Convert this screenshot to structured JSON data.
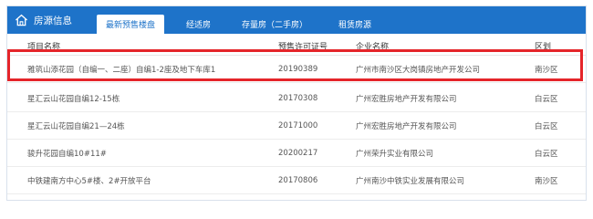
{
  "header": {
    "title": "房源信息",
    "accent_color": "#1e73c9",
    "tabs": [
      {
        "label": "最新预售楼盘",
        "active": true
      },
      {
        "label": "经适房",
        "active": false
      },
      {
        "label": "存量房（二手房）",
        "active": false
      },
      {
        "label": "租赁房源",
        "active": false
      }
    ]
  },
  "table": {
    "columns": [
      "项目名称",
      "预售许可证号",
      "企业名称",
      "区划"
    ],
    "rows": [
      {
        "name": "雅筑山添花园（自编一、二座）自编1-2座及地下车库1",
        "permit": "20190389",
        "company": "广州市南沙区大岗镇房地产开发公司",
        "district": "南沙区",
        "highlighted": true
      },
      {
        "name": "星汇云山花园自编12-15栋",
        "permit": "20170308",
        "company": "广州宏胜房地产开发有限公司",
        "district": "白云区"
      },
      {
        "name": "星汇云山花园自编21—24栋",
        "permit": "20171000",
        "company": "广州宏胜房地产开发有限公司",
        "district": "白云区"
      },
      {
        "name": "骏升花园自编10#11#",
        "permit": "20200217",
        "company": "广州荣升实业有限公司",
        "district": "白云区"
      },
      {
        "name": "中铁建南方中心5#楼、2#开放平台",
        "permit": "20170806",
        "company": "广州南沙中铁实业发展有限公司",
        "district": "南沙区"
      }
    ],
    "highlight_color": "#e5252a"
  }
}
